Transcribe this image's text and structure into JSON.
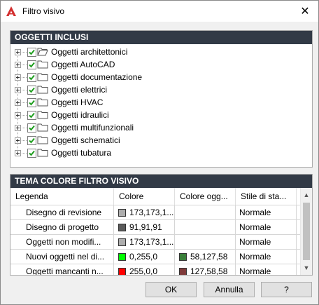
{
  "window": {
    "title": "Filtro visivo",
    "close_symbol": "✕"
  },
  "included_objects": {
    "header": "OGGETTI INCLUSI",
    "items": [
      {
        "label": "Oggetti architettonici",
        "checked": true,
        "icon": "folder-open-icon"
      },
      {
        "label": "Oggetti AutoCAD",
        "checked": true,
        "icon": "folder-icon"
      },
      {
        "label": "Oggetti documentazione",
        "checked": true,
        "icon": "folder-icon"
      },
      {
        "label": "Oggetti elettrici",
        "checked": true,
        "icon": "folder-icon"
      },
      {
        "label": "Oggetti HVAC",
        "checked": true,
        "icon": "folder-icon"
      },
      {
        "label": "Oggetti idraulici",
        "checked": true,
        "icon": "folder-icon"
      },
      {
        "label": "Oggetti multifunzionali",
        "checked": true,
        "icon": "folder-icon"
      },
      {
        "label": "Oggetti schematici",
        "checked": true,
        "icon": "folder-icon"
      },
      {
        "label": "Oggetti tubatura",
        "checked": true,
        "icon": "folder-icon"
      }
    ]
  },
  "color_theme": {
    "header": "TEMA COLORE FILTRO VISIVO",
    "columns": [
      "Legenda",
      "Colore",
      "Colore ogg...",
      "Stile di sta..."
    ],
    "rows": [
      {
        "legend": "Disegno di revisione",
        "color": "173,173,1...",
        "color_hex": "#adadad",
        "obj_color": "",
        "obj_color_hex": "",
        "style": "Normale"
      },
      {
        "legend": "Disegno di progetto",
        "color": "91,91,91",
        "color_hex": "#5b5b5b",
        "obj_color": "",
        "obj_color_hex": "",
        "style": "Normale"
      },
      {
        "legend": "Oggetti non modifi...",
        "color": "173,173,1...",
        "color_hex": "#adadad",
        "obj_color": "",
        "obj_color_hex": "",
        "style": "Normale"
      },
      {
        "legend": "Nuovi oggetti nel di...",
        "color": "0,255,0",
        "color_hex": "#00ff00",
        "obj_color": "58,127,58",
        "obj_color_hex": "#3a7f3a",
        "style": "Normale"
      },
      {
        "legend": "Oggetti mancanti n...",
        "color": "255,0,0",
        "color_hex": "#ff0000",
        "obj_color": "127,58,58",
        "obj_color_hex": "#7f3a3a",
        "style": "Normale"
      }
    ]
  },
  "buttons": {
    "ok": "OK",
    "cancel": "Annulla",
    "help": "?"
  },
  "scrollbar": {
    "up_symbol": "▲",
    "down_symbol": "▼"
  },
  "colors": {
    "header_bg": "#323a46",
    "checkbox_green": "#1e9e1e",
    "app_icon_red": "#d32f2f"
  }
}
